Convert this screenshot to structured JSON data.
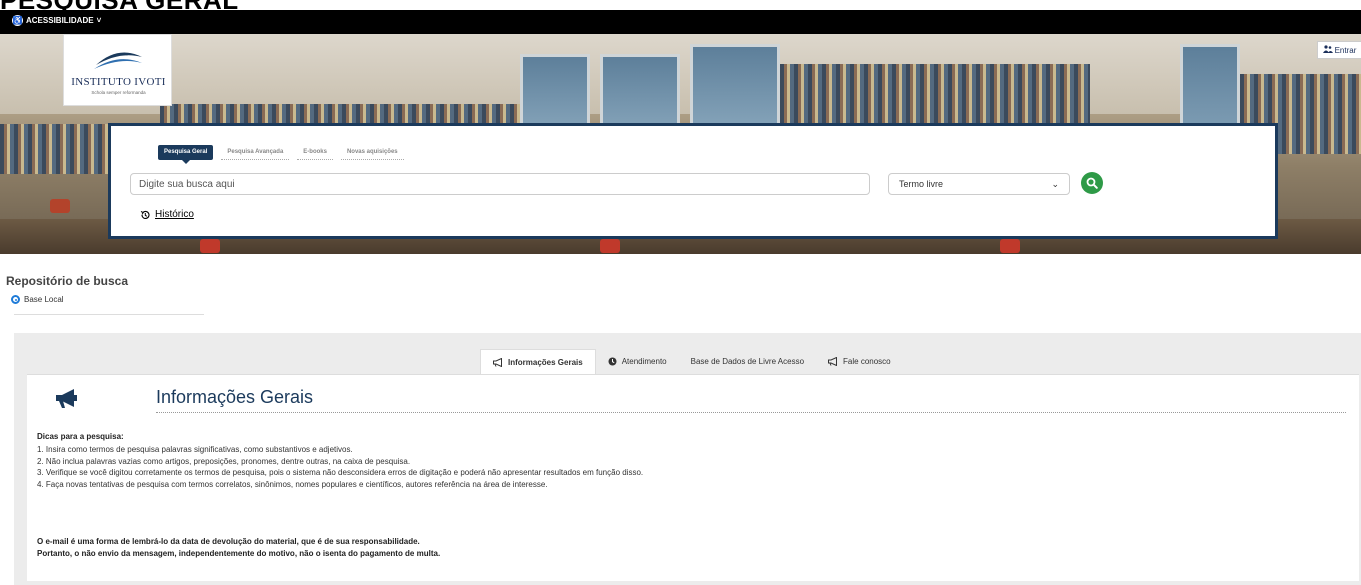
{
  "page": {
    "heading": "PESQUISA GERAL"
  },
  "topbar": {
    "accessibility_label": "ACESSIBILIDADE"
  },
  "header": {
    "logo_name": "INSTITUTO IVOTI",
    "logo_tagline": "Schola semper reformanda",
    "login_label": "Entrar"
  },
  "search": {
    "tabs": [
      {
        "label": "Pesquisa Geral",
        "active": true
      },
      {
        "label": "Pesquisa Avançada",
        "active": false
      },
      {
        "label": "E-books",
        "active": false
      },
      {
        "label": "Novas aquisições",
        "active": false
      }
    ],
    "placeholder": "Digite sua busca aqui",
    "field_type_selected": "Termo livre",
    "history_label": "Histórico"
  },
  "repository": {
    "title": "Repositório de busca",
    "option_label": "Base Local"
  },
  "info": {
    "tabs": [
      {
        "label": "Informações Gerais",
        "icon": "megaphone-icon",
        "active": true
      },
      {
        "label": "Atendimento",
        "icon": "clock-icon",
        "active": false
      },
      {
        "label": "Base de Dados de Livre Acesso",
        "icon": "",
        "active": false
      },
      {
        "label": "Fale conosco",
        "icon": "megaphone-icon",
        "active": false
      }
    ],
    "card_title": "Informações Gerais",
    "tips_title": "Dicas para a pesquisa:",
    "tips": [
      "1. Insira como termos de pesquisa palavras significativas, como substantivos e adjetivos.",
      "2. Não inclua palavras vazias como artigos, preposições, pronomes, dentre outras, na caixa de pesquisa.",
      "3. Verifique se você digitou corretamente os termos de pesquisa, pois o sistema não desconsidera erros de digitação e poderá não apresentar resultados em função disso.",
      "4. Faça novas tentativas de pesquisa com termos correlatos, sinônimos, nomes populares e científicos, autores referência na área de interesse."
    ],
    "notice_line1": "O e-mail é uma forma de lembrá-lo da data de devolução do material, que é de sua responsabilidade.",
    "notice_line2": "Portanto, o não envio da mensagem, independentemente do motivo, não o isenta do pagamento de multa."
  },
  "colors": {
    "navy": "#1b3a5c",
    "green": "#2e9a47",
    "radio_blue": "#1e7bd8"
  }
}
